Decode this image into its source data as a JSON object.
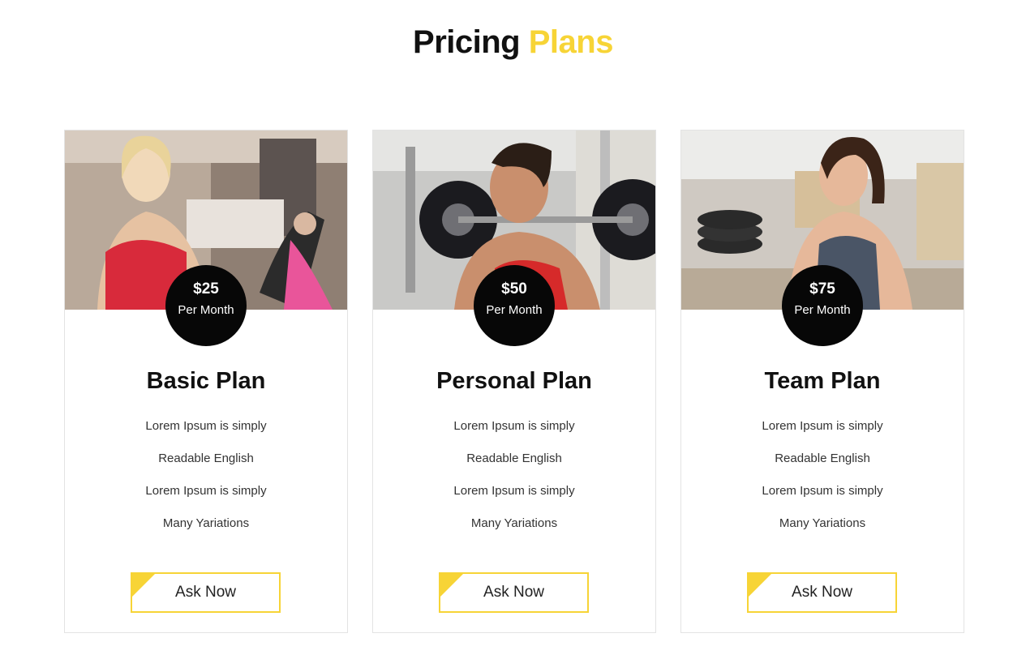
{
  "heading": {
    "main": "Pricing",
    "accent": "Plans"
  },
  "colors": {
    "accent": "#f7d436",
    "badge": "#070707",
    "border": "#e3e3e3"
  },
  "plans": [
    {
      "photo_icon": "woman-red-sports-bra-gym-photo",
      "price": "$25",
      "period": "Per Month",
      "name": "Basic Plan",
      "features": [
        "Lorem Ipsum is simply",
        "Readable English",
        "Lorem Ipsum is simply",
        "Many Yariations"
      ],
      "button_label": "Ask Now"
    },
    {
      "photo_icon": "man-lifting-barbell-gym-photo",
      "price": "$50",
      "period": "Per Month",
      "name": "Personal Plan",
      "features": [
        "Lorem Ipsum is simply",
        "Readable English",
        "Lorem Ipsum is simply",
        "Many Yariations"
      ],
      "button_label": "Ask Now"
    },
    {
      "photo_icon": "woman-earphones-gym-photo",
      "price": "$75",
      "period": "Per Month",
      "name": "Team Plan",
      "features": [
        "Lorem Ipsum is simply",
        "Readable English",
        "Lorem Ipsum is simply",
        "Many Yariations"
      ],
      "button_label": "Ask Now"
    }
  ]
}
